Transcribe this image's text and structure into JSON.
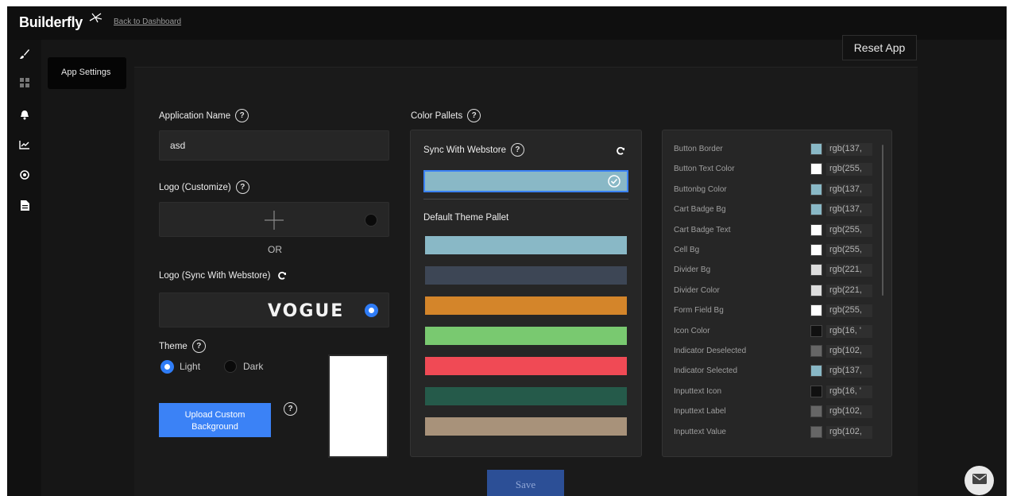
{
  "topbar": {
    "brand": "Builderfly",
    "back_link": "Back to Dashboard"
  },
  "sidebar": {
    "icons": [
      "brush-icon",
      "grid-icon",
      "bell-icon",
      "chart-icon",
      "target-icon",
      "document-icon"
    ],
    "tooltip": "App Settings"
  },
  "header": {
    "reset_label": "Reset App"
  },
  "form": {
    "app_name_label": "Application Name",
    "app_name_value": "asd",
    "logo_custom_label": "Logo (Customize)",
    "or_text": "OR",
    "logo_sync_label": "Logo (Sync With Webstore)",
    "logo_text": "VOGUE",
    "theme_label": "Theme",
    "theme_options": [
      "Light",
      "Dark"
    ],
    "theme_selected": "Light",
    "upload_label_line1": "Upload Custom",
    "upload_label_line2": "Background",
    "save_label": "Save",
    "help_glyph": "?"
  },
  "palette": {
    "title": "Color Pallets",
    "sync_label": "Sync With Webstore",
    "sync_color": "#89b8c6",
    "default_label": "Default Theme Pallet",
    "default_swatches": [
      "#89b8c6",
      "#3d4655",
      "#d4852a",
      "#79c970",
      "#f04a55",
      "#255a4a",
      "#a8927a"
    ]
  },
  "colors": [
    {
      "name": "Button Border",
      "chip": "#89b8c6",
      "value": "rgb(137,"
    },
    {
      "name": "Button Text Color",
      "chip": "#ffffff",
      "value": "rgb(255,"
    },
    {
      "name": "Buttonbg Color",
      "chip": "#89b8c6",
      "value": "rgb(137,"
    },
    {
      "name": "Cart Badge Bg",
      "chip": "#89b8c6",
      "value": "rgb(137,"
    },
    {
      "name": "Cart Badge Text",
      "chip": "#ffffff",
      "value": "rgb(255,"
    },
    {
      "name": "Cell Bg",
      "chip": "#ffffff",
      "value": "rgb(255,"
    },
    {
      "name": "Divider Bg",
      "chip": "#dddddd",
      "value": "rgb(221,"
    },
    {
      "name": "Divider Color",
      "chip": "#dddddd",
      "value": "rgb(221,"
    },
    {
      "name": "Form Field Bg",
      "chip": "#ffffff",
      "value": "rgb(255,"
    },
    {
      "name": "Icon Color",
      "chip": "#101010",
      "value": "rgb(16, '"
    },
    {
      "name": "Indicator Deselected",
      "chip": "#666666",
      "value": "rgb(102,"
    },
    {
      "name": "Indicator Selected",
      "chip": "#89b8c6",
      "value": "rgb(137,"
    },
    {
      "name": "Inputtext Icon",
      "chip": "#101010",
      "value": "rgb(16, '"
    },
    {
      "name": "Inputtext Label",
      "chip": "#666666",
      "value": "rgb(102,"
    },
    {
      "name": "Inputtext Value",
      "chip": "#666666",
      "value": "rgb(102,"
    }
  ]
}
